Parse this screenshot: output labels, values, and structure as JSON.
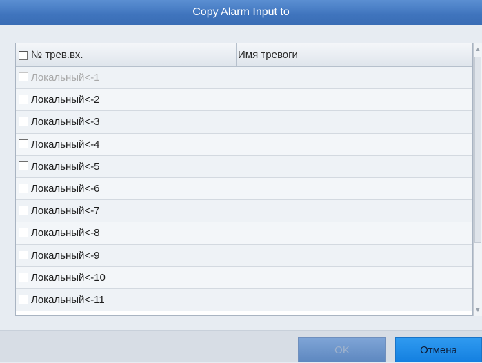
{
  "dialog": {
    "title": "Copy Alarm Input to"
  },
  "table": {
    "col_number": "№ трев.вх.",
    "col_name": "Имя тревоги",
    "rows": [
      {
        "label": "Локальный<-1",
        "disabled": true
      },
      {
        "label": "Локальный<-2",
        "disabled": false
      },
      {
        "label": "Локальный<-3",
        "disabled": false
      },
      {
        "label": "Локальный<-4",
        "disabled": false
      },
      {
        "label": "Локальный<-5",
        "disabled": false
      },
      {
        "label": "Локальный<-6",
        "disabled": false
      },
      {
        "label": "Локальный<-7",
        "disabled": false
      },
      {
        "label": "Локальный<-8",
        "disabled": false
      },
      {
        "label": "Локальный<-9",
        "disabled": false
      },
      {
        "label": "Локальный<-10",
        "disabled": false
      },
      {
        "label": "Локальный<-11",
        "disabled": false
      }
    ]
  },
  "buttons": {
    "ok_label": "OK",
    "cancel_label": "Отмена"
  },
  "colors": {
    "title_bar": "#3f74bd",
    "cancel_button": "#1480e0",
    "ok_button_disabled": "#5e88c0"
  }
}
